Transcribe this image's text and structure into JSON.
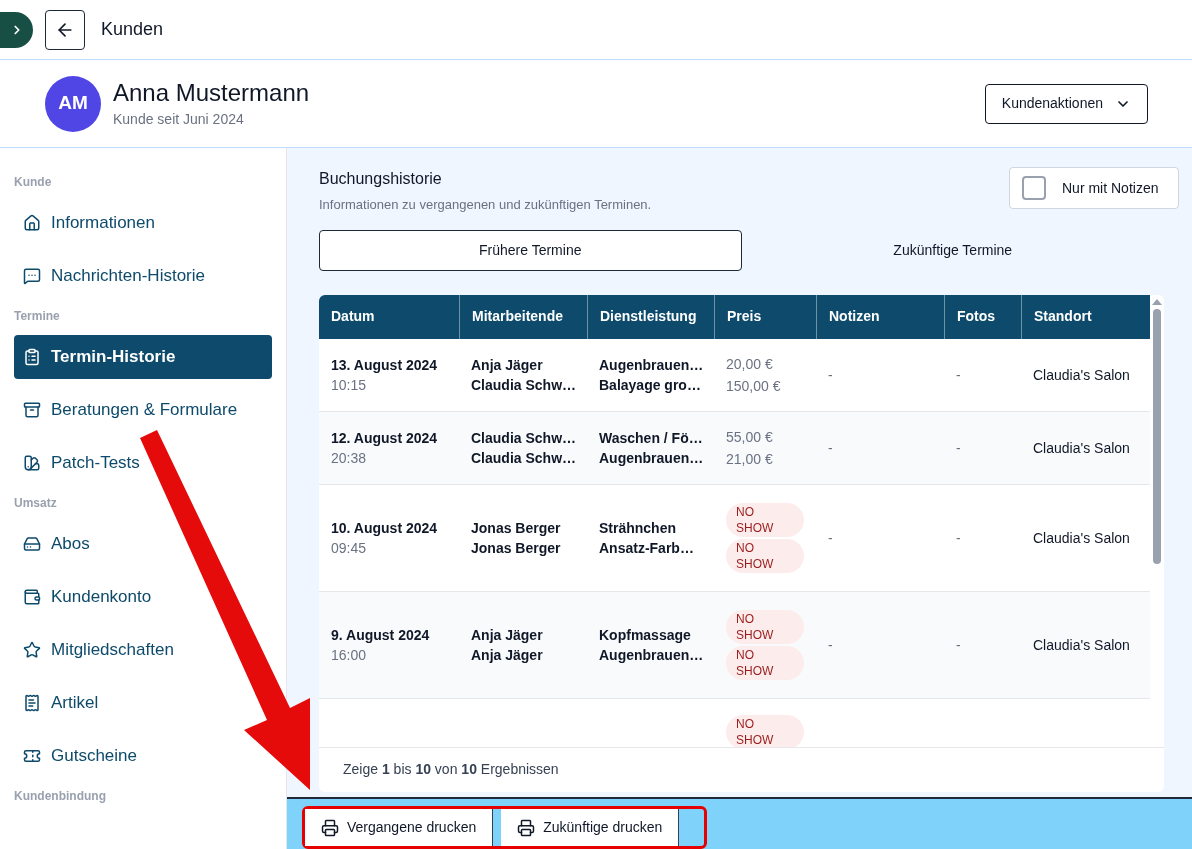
{
  "topbar": {
    "title": "Kunden"
  },
  "customer": {
    "initials": "AM",
    "name": "Anna Mustermann",
    "since": "Kunde seit Juni 2024",
    "actions_button": "Kundenaktionen"
  },
  "sidebar": {
    "sections": [
      {
        "label": "Kunde",
        "items": [
          {
            "label": "Informationen",
            "selected": false
          },
          {
            "label": "Nachrichten-Historie",
            "selected": false
          }
        ]
      },
      {
        "label": "Termine",
        "items": [
          {
            "label": "Termin-Historie",
            "selected": true
          },
          {
            "label": "Beratungen & Formulare",
            "selected": false
          },
          {
            "label": "Patch-Tests",
            "selected": false
          }
        ]
      },
      {
        "label": "Umsatz",
        "items": [
          {
            "label": "Abos",
            "selected": false
          },
          {
            "label": "Kundenkonto",
            "selected": false
          },
          {
            "label": "Mitgliedschaften",
            "selected": false
          },
          {
            "label": "Artikel",
            "selected": false
          },
          {
            "label": "Gutscheine",
            "selected": false
          }
        ]
      },
      {
        "label": "Kundenbindung"
      }
    ]
  },
  "section": {
    "title": "Buchungshistorie",
    "subtitle": "Informationen zu vergangenen und zukünftigen Terminen.",
    "filter": {
      "label": "Nur mit Notizen",
      "checked": false
    }
  },
  "tabs": [
    {
      "label": "Frühere Termine",
      "selected": true
    },
    {
      "label": "Zukünftige Termine",
      "selected": false
    }
  ],
  "table": {
    "columns": [
      "Datum",
      "Mitarbeitende",
      "Dienstleistung",
      "Preis",
      "Notizen",
      "Fotos",
      "Standort"
    ],
    "rows": [
      {
        "date": "13. August 2024",
        "time": "10:15",
        "staff": [
          "Anja Jäger",
          "Claudia Schw…"
        ],
        "services": [
          "Augenbrauen…",
          "Balayage gro…"
        ],
        "prices": [
          {
            "kind": "price",
            "text": "20,00 €"
          },
          {
            "kind": "price",
            "text": "150,00 €"
          }
        ],
        "notes": "-",
        "photos": "-",
        "location": "Claudia's Salon"
      },
      {
        "date": "12. August 2024",
        "time": "20:38",
        "staff": [
          "Claudia Schw…",
          "Claudia Schw…"
        ],
        "services": [
          "Waschen / Fö…",
          "Augenbrauen…"
        ],
        "prices": [
          {
            "kind": "price",
            "text": "55,00 €"
          },
          {
            "kind": "price",
            "text": "21,00 €"
          }
        ],
        "notes": "-",
        "photos": "-",
        "location": "Claudia's Salon"
      },
      {
        "date": "10. August 2024",
        "time": "09:45",
        "staff": [
          "Jonas Berger",
          "Jonas Berger"
        ],
        "services": [
          "Strähnchen",
          "Ansatz-Farb…"
        ],
        "prices": [
          {
            "kind": "badge",
            "text": "NO SHOW"
          },
          {
            "kind": "badge",
            "text": "NO SHOW"
          }
        ],
        "notes": "-",
        "photos": "-",
        "location": "Claudia's Salon"
      },
      {
        "date": "9. August 2024",
        "time": "16:00",
        "staff": [
          "Anja Jäger",
          "Anja Jäger"
        ],
        "services": [
          "Kopfmassage",
          "Augenbrauen…"
        ],
        "prices": [
          {
            "kind": "badge",
            "text": "NO SHOW"
          },
          {
            "kind": "badge",
            "text": "NO SHOW"
          }
        ],
        "notes": "-",
        "photos": "-",
        "location": "Claudia's Salon"
      },
      {
        "prices": [
          {
            "kind": "badge",
            "text": "NO SHOW"
          }
        ]
      }
    ],
    "footer": "Zeige **1** bis **10** von **10** Ergebnissen"
  },
  "print_buttons": [
    "Vergangene drucken",
    "Zukünftige drucken"
  ]
}
